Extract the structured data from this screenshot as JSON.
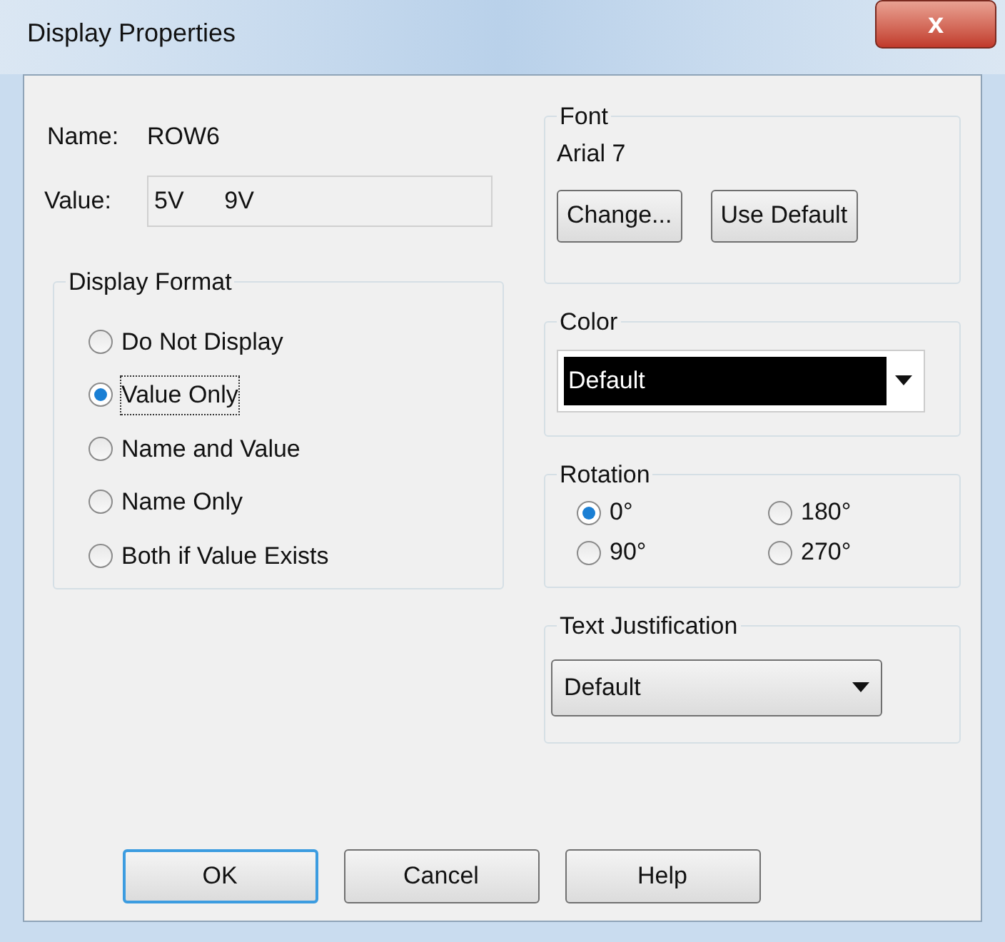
{
  "window": {
    "title": "Display Properties",
    "close": "x"
  },
  "name_row": {
    "label": "Name:",
    "value": "ROW6"
  },
  "value_row": {
    "label": "Value:",
    "value": "5V      9V"
  },
  "display_format": {
    "title": "Display Format",
    "options": [
      {
        "label": "Do Not Display",
        "selected": false
      },
      {
        "label": "Value Only",
        "selected": true
      },
      {
        "label": "Name and Value",
        "selected": false
      },
      {
        "label": "Name Only",
        "selected": false
      },
      {
        "label": "Both if Value Exists",
        "selected": false
      }
    ]
  },
  "font": {
    "title": "Font",
    "current": "Arial 7",
    "buttons": [
      {
        "label": "Change..."
      },
      {
        "label": "Use Default"
      }
    ]
  },
  "color": {
    "title": "Color",
    "value": "Default"
  },
  "rotation": {
    "title": "Rotation",
    "options": [
      {
        "label": "0°",
        "selected": true
      },
      {
        "label": "180°",
        "selected": false
      },
      {
        "label": "90°",
        "selected": false
      },
      {
        "label": "270°",
        "selected": false
      }
    ]
  },
  "text_justification": {
    "title": "Text Justification",
    "value": "Default"
  },
  "buttons": [
    {
      "label": "OK",
      "default": true
    },
    {
      "label": "Cancel",
      "default": false
    },
    {
      "label": "Help",
      "default": false
    }
  ]
}
